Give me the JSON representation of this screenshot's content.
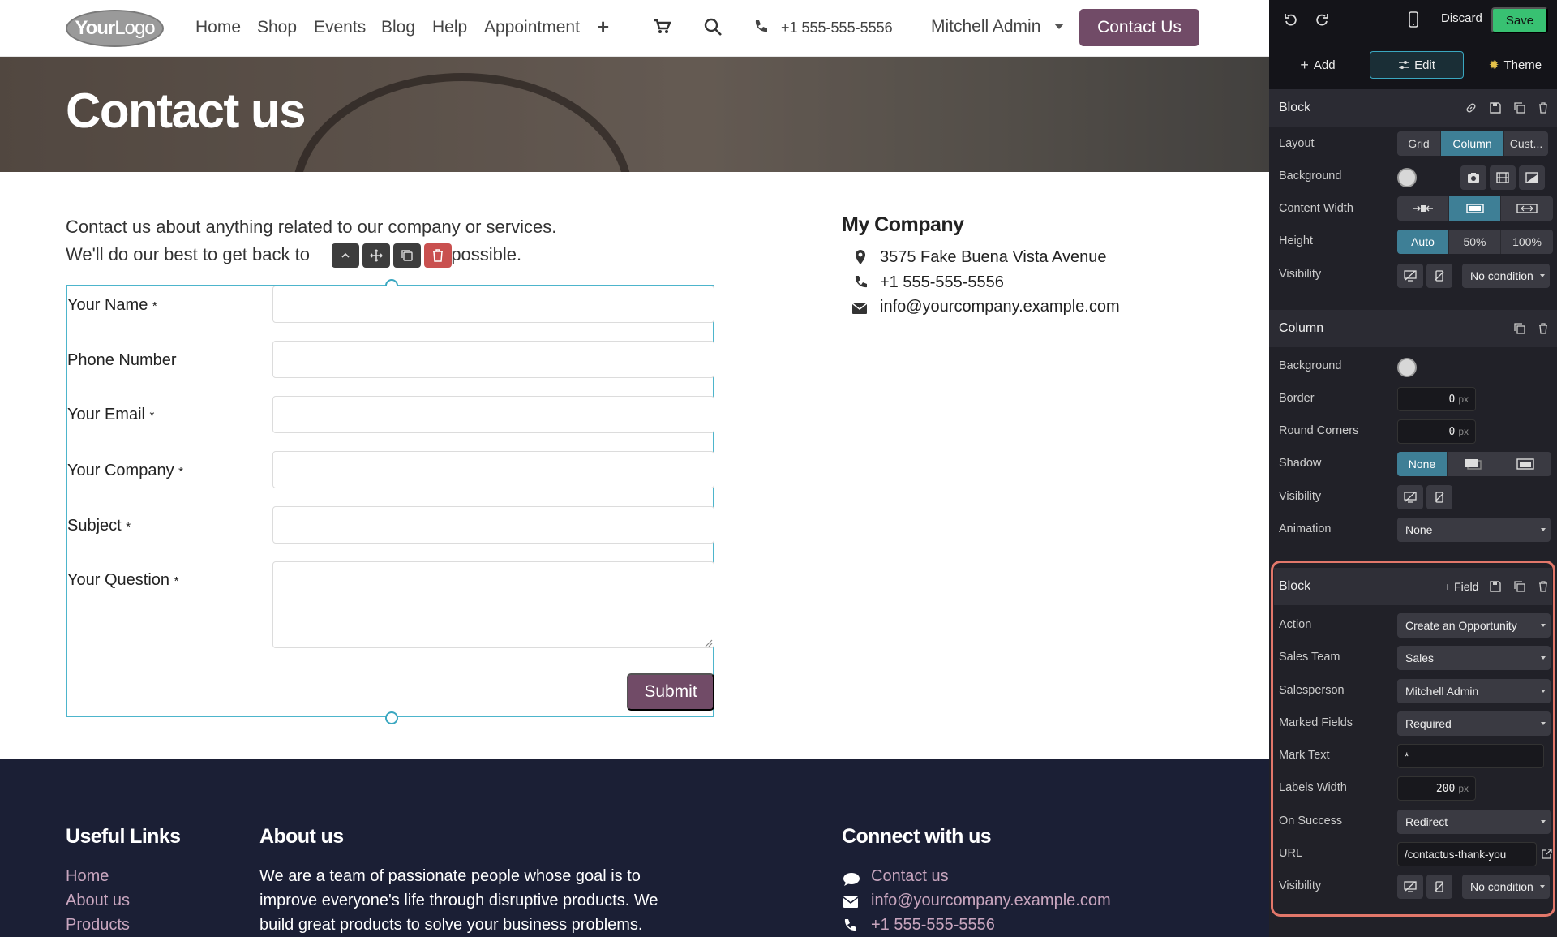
{
  "nav": {
    "logo_bold": "Your",
    "logo_light": "Logo",
    "links": [
      "Home",
      "Shop",
      "Events",
      "Blog",
      "Help",
      "Appointment"
    ],
    "phone": "+1 555-555-5556",
    "user": "Mitchell Admin",
    "cta": "Contact Us"
  },
  "hero": {
    "title": "Contact us"
  },
  "intro": {
    "line1": "Contact us about anything related to our company or services.",
    "line2_start": "We'll do our best to get back to",
    "line2_end": "as possible."
  },
  "form": {
    "fields": [
      {
        "label": "Your Name",
        "required": true
      },
      {
        "label": "Phone Number",
        "required": false
      },
      {
        "label": "Your Email",
        "required": true
      },
      {
        "label": "Your Company",
        "required": true
      },
      {
        "label": "Subject",
        "required": true
      },
      {
        "label": "Your Question",
        "required": true
      }
    ],
    "mark": "*",
    "submit": "Submit"
  },
  "company": {
    "name": "My Company",
    "address": "3575 Fake Buena Vista Avenue",
    "phone": "+1 555-555-5556",
    "email": "info@yourcompany.example.com"
  },
  "footer": {
    "useful_links_title": "Useful Links",
    "useful_links": [
      "Home",
      "About us",
      "Products"
    ],
    "about_title": "About us",
    "about_lines": [
      "We are a team of passionate people whose goal is to",
      "improve everyone's life through disruptive products. We",
      "build great products to solve your business problems."
    ],
    "connect_title": "Connect with us",
    "connect": [
      "Contact us",
      "info@yourcompany.example.com",
      "+1 555-555-5556"
    ]
  },
  "editor": {
    "discard": "Discard",
    "save": "Save",
    "tabs": [
      "Add",
      "Edit",
      "Theme"
    ],
    "block1": {
      "title": "Block",
      "layout_label": "Layout",
      "layout_options": [
        "Grid",
        "Column",
        "Cust..."
      ],
      "background_label": "Background",
      "content_width_label": "Content Width",
      "height_label": "Height",
      "height_options": [
        "Auto",
        "50%",
        "100%"
      ],
      "visibility_label": "Visibility",
      "visibility_value": "No condition"
    },
    "column": {
      "title": "Column",
      "background_label": "Background",
      "border_label": "Border",
      "border_value": "0",
      "round_label": "Round Corners",
      "round_value": "0",
      "unit": "px",
      "shadow_label": "Shadow",
      "shadow_value": "None",
      "visibility_label": "Visibility",
      "animation_label": "Animation",
      "animation_value": "None"
    },
    "block2": {
      "title": "Block",
      "add_field": "+ Field",
      "rows": [
        {
          "label": "Action",
          "value": "Create an Opportunity"
        },
        {
          "label": "Sales Team",
          "value": "Sales"
        },
        {
          "label": "Salesperson",
          "value": "Mitchell Admin"
        },
        {
          "label": "Marked Fields",
          "value": "Required"
        },
        {
          "label": "Mark Text",
          "value": "*"
        },
        {
          "label": "Labels Width",
          "value": "200"
        },
        {
          "label": "On Success",
          "value": "Redirect"
        },
        {
          "label": "URL",
          "value": "/contactus-thank-you"
        },
        {
          "label": "Visibility",
          "value": "No condition"
        }
      ]
    }
  }
}
